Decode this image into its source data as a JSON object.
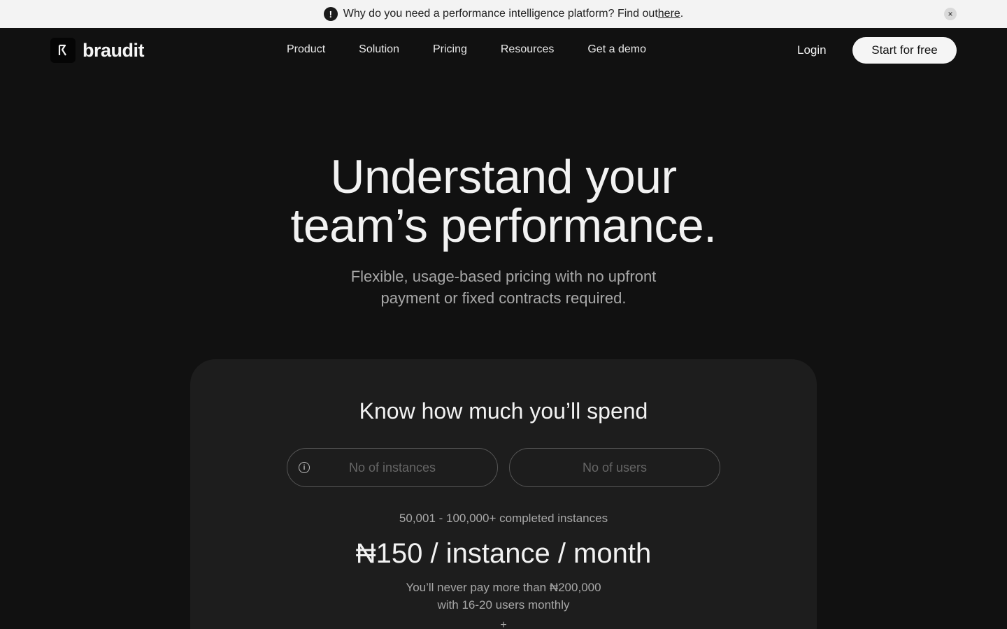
{
  "banner": {
    "text": "Why do you need a performance intelligence platform? Find out ",
    "link": "here",
    "suffix": ".",
    "alert_icon": "!",
    "close_icon": "×"
  },
  "nav": {
    "logo": "braudit",
    "links": [
      "Product",
      "Solution",
      "Pricing",
      "Resources",
      "Get a demo"
    ],
    "login": "Login",
    "cta": "Start for free"
  },
  "hero": {
    "title_line1": "Understand your",
    "title_line2": "team’s performance.",
    "subtitle_line1": "Flexible, usage-based pricing with no upfront",
    "subtitle_line2": "payment or fixed contracts required."
  },
  "calculator": {
    "title": "Know how much you’ll spend",
    "instances_placeholder": "No of instances",
    "users_placeholder": "No of users",
    "tier": "50,001 - 100,000+ completed instances",
    "price": "₦150 / instance / month",
    "note_line1": "You’ll never pay more than ₦200,000",
    "note_line2": "with 16-20 users monthly",
    "plus": "+"
  }
}
